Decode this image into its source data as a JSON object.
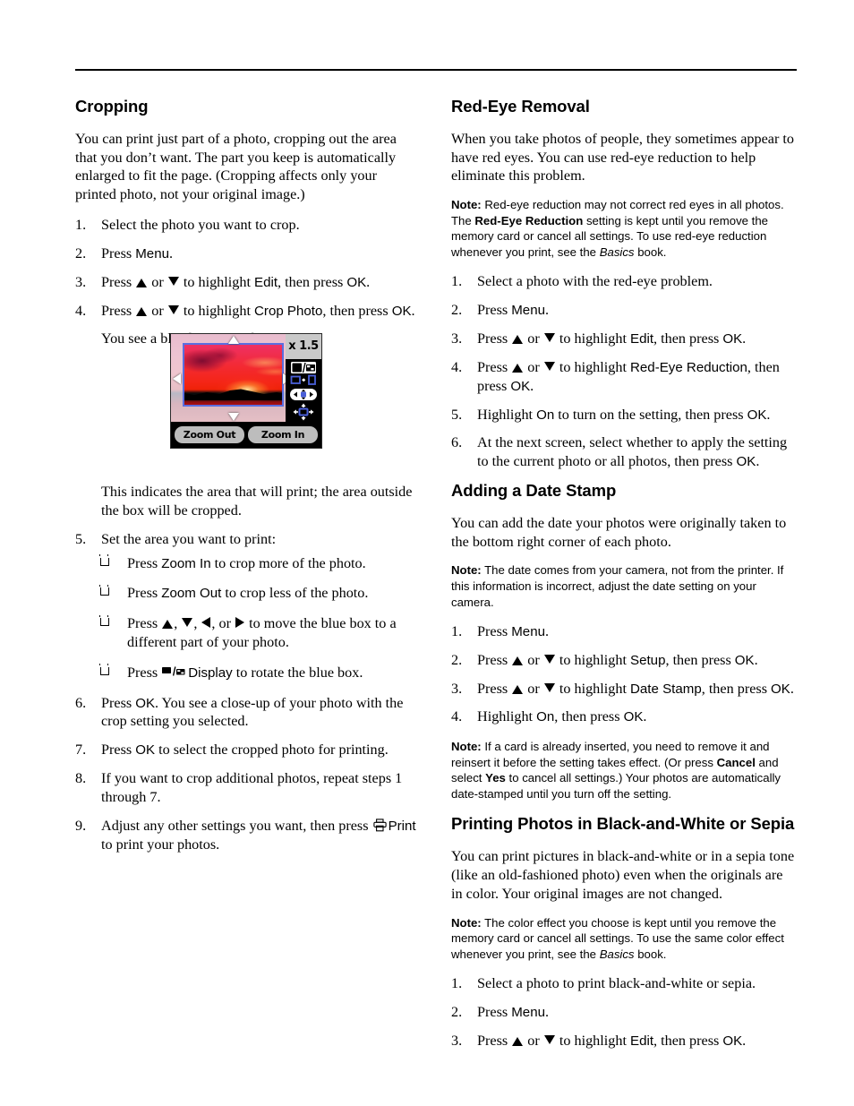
{
  "document": {
    "type": "printer-user-guide-page"
  },
  "left_column": {
    "heading": "Cropping",
    "intro": "You can print just part of a photo, cropping out the area that you don’t want. The part you keep is automatically enlarged to fit the page. (Cropping affects only your printed photo, not your original image.)",
    "steps": [
      {
        "num": "1.",
        "text_before": "Select the photo you want to crop."
      },
      {
        "num": "2.",
        "text_before": "Press ",
        "key1": "Menu",
        "text_after": "."
      },
      {
        "num": "3.",
        "text_before": "Press ",
        "mid": " or ",
        "text_mid2": " to highlight ",
        "key1": "Edit",
        "text_after": ", then press ",
        "key2": "OK",
        "text_end": "."
      },
      {
        "num": "4.",
        "text_before": "Press ",
        "mid": " or ",
        "text_mid2": " to highlight ",
        "key1": "Crop Photo",
        "text_after": ", then press ",
        "key2": "OK",
        "text_end": "."
      }
    ],
    "continuation_1": "You see a blue box around the photo:",
    "continuation_2": "This indicates the area that will print; the area outside the box will be cropped.",
    "step5": {
      "num": "5.",
      "text": "Set the area you want to print:"
    },
    "bullets": [
      {
        "text_before": "Press ",
        "key1": "Zoom In",
        "text_after": " to crop more of the photo."
      },
      {
        "text_before": "Press ",
        "key1": "Zoom Out",
        "text_after": " to crop less of the photo."
      },
      {
        "text_before": "Press ",
        "text_after": " to move the blue box to a different part of your photo."
      },
      {
        "text_before": "Press ",
        "key1": "Display",
        "text_after": " to rotate the blue box."
      }
    ],
    "steps_tail": [
      {
        "num": "6.",
        "text_before": "Press ",
        "key1": "OK",
        "text_after": ". You see a close-up of your photo with the crop setting you selected."
      },
      {
        "num": "7.",
        "text_before": "Press ",
        "key1": "OK",
        "text_after": " to select the cropped photo for printing."
      },
      {
        "num": "8.",
        "text_before": "If you want to crop additional photos, repeat steps 1 through 7."
      },
      {
        "num": "9.",
        "text_before": "Adjust any other settings you want, then press ",
        "key1": "Print",
        "text_after": " to print your photos."
      }
    ]
  },
  "lcd": {
    "zoom_level": "x 1.5",
    "button_zoom_out": "Zoom Out",
    "button_zoom_in": "Zoom In",
    "icons": [
      "display-toggle-icon",
      "orientation-toggle-icon",
      "four-way-nav-icon",
      "move-box-icon"
    ],
    "crop_box_color": "#5a6ee0",
    "panel_color": "#000000",
    "zoom_label_bg": "#c9c9c9",
    "button_bg": "#bdbdbd"
  },
  "right_column": {
    "section_redeye": {
      "heading": "Red-Eye Removal",
      "intro": "When you take photos of people, they sometimes appear to have red eyes. You can use red-eye reduction to help eliminate this problem.",
      "note_label": "Note:",
      "note_part1": " Red-eye reduction may not correct red eyes in all photos. The ",
      "note_bold": "Red-Eye Reduction",
      "note_part2": " setting is kept until you remove the memory card or cancel all settings. To use red-eye reduction whenever you print, see the ",
      "note_italic": "Basics",
      "note_part3": " book.",
      "steps": [
        {
          "num": "1.",
          "text_before": "Select a photo with the red-eye problem."
        },
        {
          "num": "2.",
          "text_before": "Press ",
          "key1": "Menu",
          "text_after": "."
        },
        {
          "num": "3.",
          "text_before": "Press ",
          "mid": " or ",
          "text_mid2": " to highlight ",
          "key1": "Edit",
          "text_after": ", then press ",
          "key2": "OK",
          "text_end": "."
        },
        {
          "num": "4.",
          "text_before": "Press ",
          "mid": " or ",
          "text_mid2": " to highlight ",
          "key1": "Red-Eye Reduction",
          "text_after": ", then press ",
          "key2": "OK",
          "text_end": "."
        },
        {
          "num": "5.",
          "text_before": "Highlight ",
          "key1": "On",
          "text_after": " to turn on the setting, then press ",
          "key2": "OK",
          "text_end": "."
        },
        {
          "num": "6.",
          "text_before": "At the next screen, select whether to apply the setting to the current photo or all photos, then press ",
          "key1": "OK",
          "text_after": "."
        }
      ]
    },
    "section_datestamp": {
      "heading": "Adding a Date Stamp",
      "intro": "You can add the date your photos were originally taken to the bottom right corner of each photo.",
      "note_label": "Note:",
      "note_text": " The date comes from your camera, not from the printer. If this information is incorrect, adjust the date setting on your camera.",
      "steps": [
        {
          "num": "1.",
          "text_before": "Press ",
          "key1": "Menu",
          "text_after": "."
        },
        {
          "num": "2.",
          "text_before": "Press ",
          "mid": " or ",
          "text_mid2": " to highlight ",
          "key1": "Setup",
          "text_after": ", then press ",
          "key2": "OK",
          "text_end": "."
        },
        {
          "num": "3.",
          "text_before": "Press ",
          "mid": " or ",
          "text_mid2": " to highlight ",
          "key1": "Date Stamp",
          "text_after": ", then press ",
          "key2": "OK",
          "text_end": "."
        },
        {
          "num": "4.",
          "text_before": "Highlight ",
          "key1": "On",
          "text_after": ", then press ",
          "key2": "OK",
          "text_end": "."
        }
      ],
      "note2_label": "Note:",
      "note2_part1": " If a card is already inserted, you need to remove it and reinsert it before the setting takes effect. (Or press ",
      "note2_bold1": "Cancel",
      "note2_part2": " and select ",
      "note2_bold2": "Yes",
      "note2_part3": " to cancel all settings.) Your photos are automatically date-stamped until you turn off the setting."
    },
    "section_bw": {
      "heading": "Printing Photos in Black-and-White or Sepia",
      "intro": "You can print pictures in black-and-white or in a sepia tone (like an old-fashioned photo) even when the originals are in color. Your original images are not changed.",
      "note_label": "Note:",
      "note_part1": " The color effect you choose is kept until you remove the memory card or cancel all settings. To use the same color effect whenever you print, see the ",
      "note_italic": "Basics",
      "note_part2": " book.",
      "steps": [
        {
          "num": "1.",
          "text_before": "Select a photo to print black-and-white or sepia."
        },
        {
          "num": "2.",
          "text_before": "Press ",
          "key1": "Menu",
          "text_after": "."
        },
        {
          "num": "3.",
          "text_before": "Press ",
          "mid": " or ",
          "text_mid2": " to highlight ",
          "key1": "Edit",
          "text_after": ", then press ",
          "key2": "OK",
          "text_end": "."
        }
      ]
    }
  }
}
